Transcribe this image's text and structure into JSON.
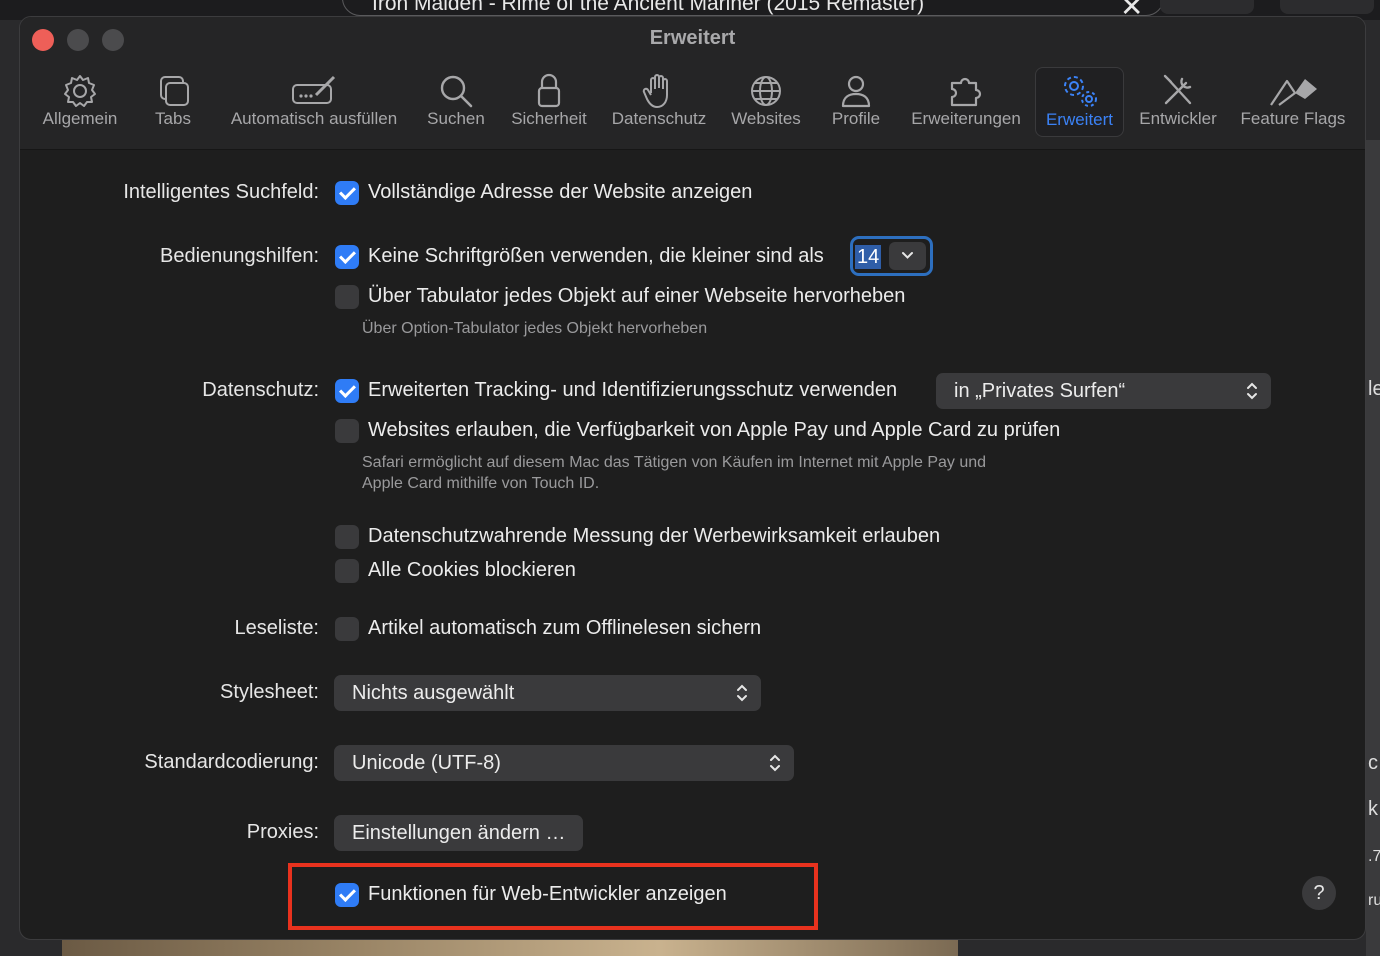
{
  "background": {
    "now_playing": "Iron Maiden - Rime of the Ancient Mariner (2015 Remaster)",
    "edge_letters": [
      "le",
      "c",
      "k",
      ".7",
      "ru"
    ]
  },
  "window": {
    "title": "Erweitert",
    "tabs": [
      {
        "label": "Allgemein",
        "icon": "gear-icon"
      },
      {
        "label": "Tabs",
        "icon": "tabs-icon"
      },
      {
        "label": "Automatisch ausfüllen",
        "icon": "autofill-icon"
      },
      {
        "label": "Suchen",
        "icon": "search-icon"
      },
      {
        "label": "Sicherheit",
        "icon": "lock-icon"
      },
      {
        "label": "Datenschutz",
        "icon": "hand-icon"
      },
      {
        "label": "Websites",
        "icon": "globe-icon"
      },
      {
        "label": "Profile",
        "icon": "person-icon"
      },
      {
        "label": "Erweiterungen",
        "icon": "puzzle-icon"
      },
      {
        "label": "Erweitert",
        "icon": "gears-icon",
        "active": true
      },
      {
        "label": "Entwickler",
        "icon": "tools-icon"
      },
      {
        "label": "Feature Flags",
        "icon": "flags-icon"
      }
    ]
  },
  "settings": {
    "smart_search": {
      "label": "Intelligentes Suchfeld:",
      "option": "Vollständige Adresse der Website anzeigen",
      "checked": true
    },
    "accessibility": {
      "label": "Bedienungshilfen:",
      "min_font_option": "Keine Schriftgrößen verwenden, die kleiner sind als",
      "min_font_checked": true,
      "min_font_value": "14",
      "tab_option": "Über Tabulator jedes Objekt auf einer Webseite hervorheben",
      "tab_checked": false,
      "tab_note": "Über Option-Tabulator jedes Objekt hervorheben"
    },
    "privacy": {
      "label": "Datenschutz:",
      "tracking_option": "Erweiterten Tracking- und Identifizierungsschutz verwenden",
      "tracking_checked": true,
      "tracking_mode": "in „Privates Surfen“",
      "applepay_option": "Websites erlauben, die Verfügbarkeit von Apple Pay und Apple Card zu prüfen",
      "applepay_checked": false,
      "applepay_note_1": "Safari ermöglicht auf diesem Mac das Tätigen von Käufen im Internet mit Apple Pay und",
      "applepay_note_2": "Apple Card mithilfe von Touch ID.",
      "ad_measure_option": "Datenschutzwahrende Messung der Werbewirksamkeit erlauben",
      "ad_measure_checked": false,
      "cookies_option": "Alle Cookies blockieren",
      "cookies_checked": false
    },
    "reading_list": {
      "label": "Leseliste:",
      "option": "Artikel automatisch zum Offlinelesen sichern",
      "checked": false
    },
    "stylesheet": {
      "label": "Stylesheet:",
      "value": "Nichts ausgewählt"
    },
    "encoding": {
      "label": "Standardcodierung:",
      "value": "Unicode (UTF-8)"
    },
    "proxies": {
      "label": "Proxies:",
      "button": "Einstellungen ändern …"
    },
    "developer": {
      "option": "Funktionen für Web-Entwickler anzeigen",
      "checked": true
    },
    "help": "?"
  },
  "colors": {
    "accent": "#2f7cf6",
    "highlight_box": "#e8321e",
    "close_button": "#ee5f58"
  }
}
